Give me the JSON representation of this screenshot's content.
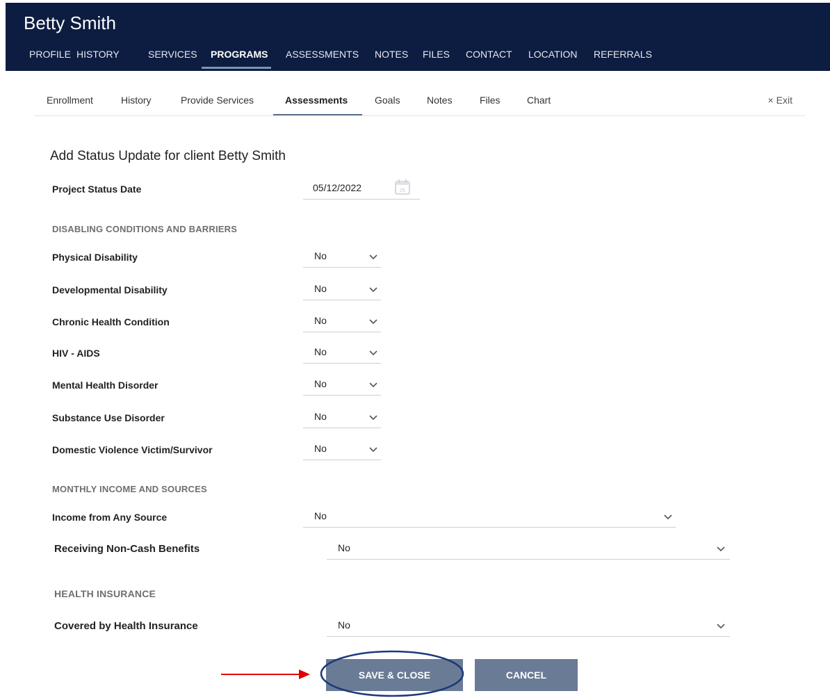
{
  "header": {
    "client_name": "Betty Smith",
    "nav": [
      "PROFILE",
      "HISTORY",
      "SERVICES",
      "PROGRAMS",
      "ASSESSMENTS",
      "NOTES",
      "FILES",
      "CONTACT",
      "LOCATION",
      "REFERRALS"
    ],
    "active_nav": "PROGRAMS"
  },
  "sub_tabs": {
    "items": [
      "Enrollment",
      "History",
      "Provide Services",
      "Assessments",
      "Goals",
      "Notes",
      "Files",
      "Chart"
    ],
    "active": "Assessments",
    "exit_icon": "×",
    "exit_label": "Exit"
  },
  "form": {
    "title": "Add Status Update for client Betty Smith",
    "project_status_date": {
      "label": "Project Status Date",
      "value": "05/12/2022",
      "icon": "calendar-icon",
      "icon_text": "25"
    },
    "section_disabling": "DISABLING CONDITIONS AND BARRIERS",
    "disabling": [
      {
        "label": "Physical Disability",
        "value": "No"
      },
      {
        "label": "Developmental Disability",
        "value": "No"
      },
      {
        "label": "Chronic Health Condition",
        "value": "No"
      },
      {
        "label": "HIV - AIDS",
        "value": "No"
      },
      {
        "label": "Mental Health Disorder",
        "value": "No"
      },
      {
        "label": "Substance Use Disorder",
        "value": "No"
      },
      {
        "label": "Domestic Violence Victim/Survivor",
        "value": "No"
      }
    ],
    "section_income": "MONTHLY INCOME AND SOURCES",
    "income_any": {
      "label": "Income from Any Source",
      "value": "No"
    },
    "non_cash": {
      "label": "Receiving Non-Cash Benefits",
      "value": "No"
    },
    "section_health": "HEALTH INSURANCE",
    "health": {
      "label": "Covered by Health Insurance",
      "value": "No"
    }
  },
  "buttons": {
    "save_close": "SAVE & CLOSE",
    "cancel": "CANCEL"
  },
  "colors": {
    "header_bg": "#0d1c41",
    "button_bg": "#6a7b95",
    "annotation_ellipse": "#1b3a78",
    "annotation_arrow": "#e00000"
  }
}
